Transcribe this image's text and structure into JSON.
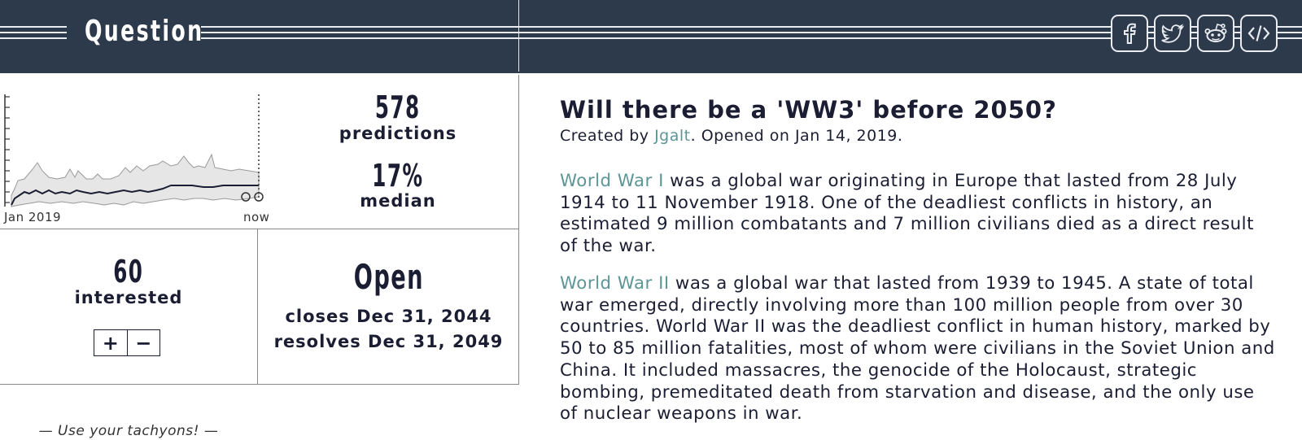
{
  "header": {
    "title": "Question",
    "share_buttons": [
      {
        "icon": "facebook-icon"
      },
      {
        "icon": "twitter-icon"
      },
      {
        "icon": "reddit-icon"
      },
      {
        "icon": "embed-code-icon"
      }
    ]
  },
  "chart": {
    "x_start_label": "Jan 2019",
    "x_end_label": "now"
  },
  "stats": {
    "predictions_count": "578",
    "predictions_label": "predictions",
    "median_value": "17%",
    "median_label": "median",
    "interested_count": "60",
    "interested_label": "interested",
    "plus_label": "+",
    "minus_label": "−",
    "status": "Open",
    "closes": "closes Dec 31, 2044",
    "resolves": "resolves Dec 31, 2049"
  },
  "footer": {
    "tachyons": "— Use your tachyons! —"
  },
  "question": {
    "title": "Will there be a 'WW3' before 2050?",
    "created_prefix": "Created by ",
    "author": "Jgalt",
    "opened": ". Opened on Jan 14, 2019.",
    "para1_link": "World War I",
    "para1_text": " was a global war originating in Europe that lasted from 28 July 1914 to 11 November 1918. One of the deadliest conflicts in history, an estimated 9 million combatants and 7 million civilians died as a direct result of the war.",
    "para2_link": "World War II",
    "para2_text": " was a global war that lasted from 1939 to 1945. A state of total war emerged, directly involving more than 100 million people from over 30 countries. World War II was the deadliest conflict in human history, marked by 50 to 85 million fatalities, most of whom were civilians in the Soviet Union and China. It included massacres, the genocide of the Holocaust, strategic bombing, premeditated death from starvation and disease, and the only use of nuclear weapons in war."
  },
  "colors": {
    "header_bg": "#2d3a4b",
    "link": "#5d9696",
    "text": "#1b1e33"
  }
}
